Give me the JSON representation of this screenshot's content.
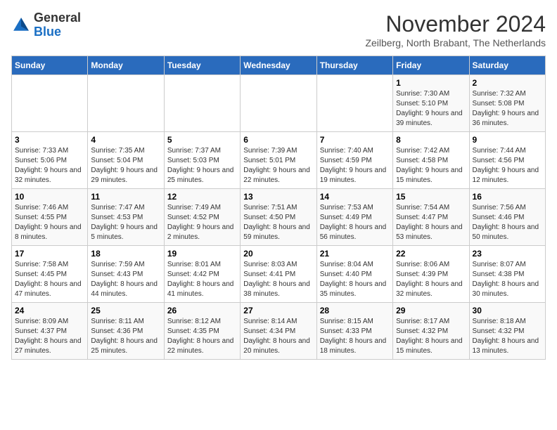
{
  "header": {
    "logo_general": "General",
    "logo_blue": "Blue",
    "month_title": "November 2024",
    "subtitle": "Zeilberg, North Brabant, The Netherlands"
  },
  "weekdays": [
    "Sunday",
    "Monday",
    "Tuesday",
    "Wednesday",
    "Thursday",
    "Friday",
    "Saturday"
  ],
  "weeks": [
    [
      {
        "day": "",
        "info": ""
      },
      {
        "day": "",
        "info": ""
      },
      {
        "day": "",
        "info": ""
      },
      {
        "day": "",
        "info": ""
      },
      {
        "day": "",
        "info": ""
      },
      {
        "day": "1",
        "info": "Sunrise: 7:30 AM\nSunset: 5:10 PM\nDaylight: 9 hours and 39 minutes."
      },
      {
        "day": "2",
        "info": "Sunrise: 7:32 AM\nSunset: 5:08 PM\nDaylight: 9 hours and 36 minutes."
      }
    ],
    [
      {
        "day": "3",
        "info": "Sunrise: 7:33 AM\nSunset: 5:06 PM\nDaylight: 9 hours and 32 minutes."
      },
      {
        "day": "4",
        "info": "Sunrise: 7:35 AM\nSunset: 5:04 PM\nDaylight: 9 hours and 29 minutes."
      },
      {
        "day": "5",
        "info": "Sunrise: 7:37 AM\nSunset: 5:03 PM\nDaylight: 9 hours and 25 minutes."
      },
      {
        "day": "6",
        "info": "Sunrise: 7:39 AM\nSunset: 5:01 PM\nDaylight: 9 hours and 22 minutes."
      },
      {
        "day": "7",
        "info": "Sunrise: 7:40 AM\nSunset: 4:59 PM\nDaylight: 9 hours and 19 minutes."
      },
      {
        "day": "8",
        "info": "Sunrise: 7:42 AM\nSunset: 4:58 PM\nDaylight: 9 hours and 15 minutes."
      },
      {
        "day": "9",
        "info": "Sunrise: 7:44 AM\nSunset: 4:56 PM\nDaylight: 9 hours and 12 minutes."
      }
    ],
    [
      {
        "day": "10",
        "info": "Sunrise: 7:46 AM\nSunset: 4:55 PM\nDaylight: 9 hours and 8 minutes."
      },
      {
        "day": "11",
        "info": "Sunrise: 7:47 AM\nSunset: 4:53 PM\nDaylight: 9 hours and 5 minutes."
      },
      {
        "day": "12",
        "info": "Sunrise: 7:49 AM\nSunset: 4:52 PM\nDaylight: 9 hours and 2 minutes."
      },
      {
        "day": "13",
        "info": "Sunrise: 7:51 AM\nSunset: 4:50 PM\nDaylight: 8 hours and 59 minutes."
      },
      {
        "day": "14",
        "info": "Sunrise: 7:53 AM\nSunset: 4:49 PM\nDaylight: 8 hours and 56 minutes."
      },
      {
        "day": "15",
        "info": "Sunrise: 7:54 AM\nSunset: 4:47 PM\nDaylight: 8 hours and 53 minutes."
      },
      {
        "day": "16",
        "info": "Sunrise: 7:56 AM\nSunset: 4:46 PM\nDaylight: 8 hours and 50 minutes."
      }
    ],
    [
      {
        "day": "17",
        "info": "Sunrise: 7:58 AM\nSunset: 4:45 PM\nDaylight: 8 hours and 47 minutes."
      },
      {
        "day": "18",
        "info": "Sunrise: 7:59 AM\nSunset: 4:43 PM\nDaylight: 8 hours and 44 minutes."
      },
      {
        "day": "19",
        "info": "Sunrise: 8:01 AM\nSunset: 4:42 PM\nDaylight: 8 hours and 41 minutes."
      },
      {
        "day": "20",
        "info": "Sunrise: 8:03 AM\nSunset: 4:41 PM\nDaylight: 8 hours and 38 minutes."
      },
      {
        "day": "21",
        "info": "Sunrise: 8:04 AM\nSunset: 4:40 PM\nDaylight: 8 hours and 35 minutes."
      },
      {
        "day": "22",
        "info": "Sunrise: 8:06 AM\nSunset: 4:39 PM\nDaylight: 8 hours and 32 minutes."
      },
      {
        "day": "23",
        "info": "Sunrise: 8:07 AM\nSunset: 4:38 PM\nDaylight: 8 hours and 30 minutes."
      }
    ],
    [
      {
        "day": "24",
        "info": "Sunrise: 8:09 AM\nSunset: 4:37 PM\nDaylight: 8 hours and 27 minutes."
      },
      {
        "day": "25",
        "info": "Sunrise: 8:11 AM\nSunset: 4:36 PM\nDaylight: 8 hours and 25 minutes."
      },
      {
        "day": "26",
        "info": "Sunrise: 8:12 AM\nSunset: 4:35 PM\nDaylight: 8 hours and 22 minutes."
      },
      {
        "day": "27",
        "info": "Sunrise: 8:14 AM\nSunset: 4:34 PM\nDaylight: 8 hours and 20 minutes."
      },
      {
        "day": "28",
        "info": "Sunrise: 8:15 AM\nSunset: 4:33 PM\nDaylight: 8 hours and 18 minutes."
      },
      {
        "day": "29",
        "info": "Sunrise: 8:17 AM\nSunset: 4:32 PM\nDaylight: 8 hours and 15 minutes."
      },
      {
        "day": "30",
        "info": "Sunrise: 8:18 AM\nSunset: 4:32 PM\nDaylight: 8 hours and 13 minutes."
      }
    ]
  ]
}
